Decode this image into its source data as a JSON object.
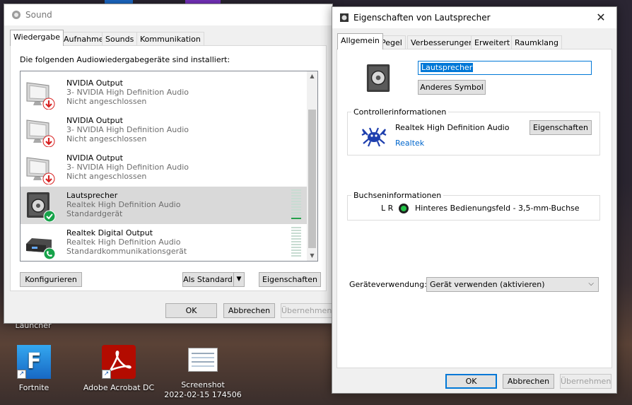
{
  "desktop": {
    "launcher_label": "Launcher",
    "icons": [
      {
        "label": "Fortnite",
        "letter": "F",
        "shortcut_glyph": "↗"
      },
      {
        "label": "Adobe Acrobat DC",
        "shortcut_glyph": "↗"
      },
      {
        "label": "Screenshot\n2022-02-15 174506"
      }
    ]
  },
  "sound_window": {
    "title": "Sound",
    "tabs": [
      "Wiedergabe",
      "Aufnahme",
      "Sounds",
      "Kommunikation"
    ],
    "intro": "Die folgenden Audiowiedergabegeräte sind installiert:",
    "devices": [
      {
        "name": "NVIDIA Output",
        "description": "3- NVIDIA High Definition Audio",
        "status": "Nicht angeschlossen",
        "icon": "monitor-icon",
        "badge": "disconnected-badge-icon"
      },
      {
        "name": "NVIDIA Output",
        "description": "3- NVIDIA High Definition Audio",
        "status": "Nicht angeschlossen",
        "icon": "monitor-icon",
        "badge": "disconnected-badge-icon"
      },
      {
        "name": "NVIDIA Output",
        "description": "3- NVIDIA High Definition Audio",
        "status": "Nicht angeschlossen",
        "icon": "monitor-icon",
        "badge": "disconnected-badge-icon"
      },
      {
        "name": "Lautsprecher",
        "description": "Realtek High Definition Audio",
        "status": "Standardgerät",
        "icon": "speaker-icon",
        "badge": "default-check-icon",
        "selected": true
      },
      {
        "name": "Realtek Digital Output",
        "description": "Realtek High Definition Audio",
        "status": "Standardkommunikationsgerät",
        "icon": "digital-output-icon",
        "badge": "phone-badge-icon"
      }
    ],
    "buttons": {
      "configure": "Konfigurieren",
      "set_default": "Als Standard",
      "set_default_arrow": "▼",
      "properties": "Eigenschaften",
      "ok": "OK",
      "cancel": "Abbrechen",
      "apply": "Übernehmen"
    }
  },
  "props_window": {
    "title": "Eigenschaften von Lautsprecher",
    "close_glyph": "✕",
    "tabs": [
      "Allgemein",
      "Pegel",
      "Verbesserungen",
      "Erweitert",
      "Raumklang"
    ],
    "device_name_value": "Lautsprecher",
    "change_icon_button": "Anderes Symbol",
    "controller_section": {
      "title": "Controllerinformationen",
      "controller_name": "Realtek High Definition Audio",
      "vendor_link": "Realtek",
      "properties_button": "Eigenschaften"
    },
    "jack_section": {
      "title": "Buchseninformationen",
      "channels": "L R",
      "jack_description": "Hinteres Bedienungsfeld - 3,5-mm-Buchse"
    },
    "usage": {
      "label": "Geräteverwendung:",
      "selected": "Gerät verwenden (aktivieren)",
      "chevron": "⌵"
    },
    "buttons": {
      "ok": "OK",
      "cancel": "Abbrechen",
      "apply": "Übernehmen"
    }
  },
  "colors": {
    "accent": "#0078d7",
    "meter_on": "#22a14a",
    "disconnected": "#d82121",
    "default_ok": "#17a34a"
  }
}
